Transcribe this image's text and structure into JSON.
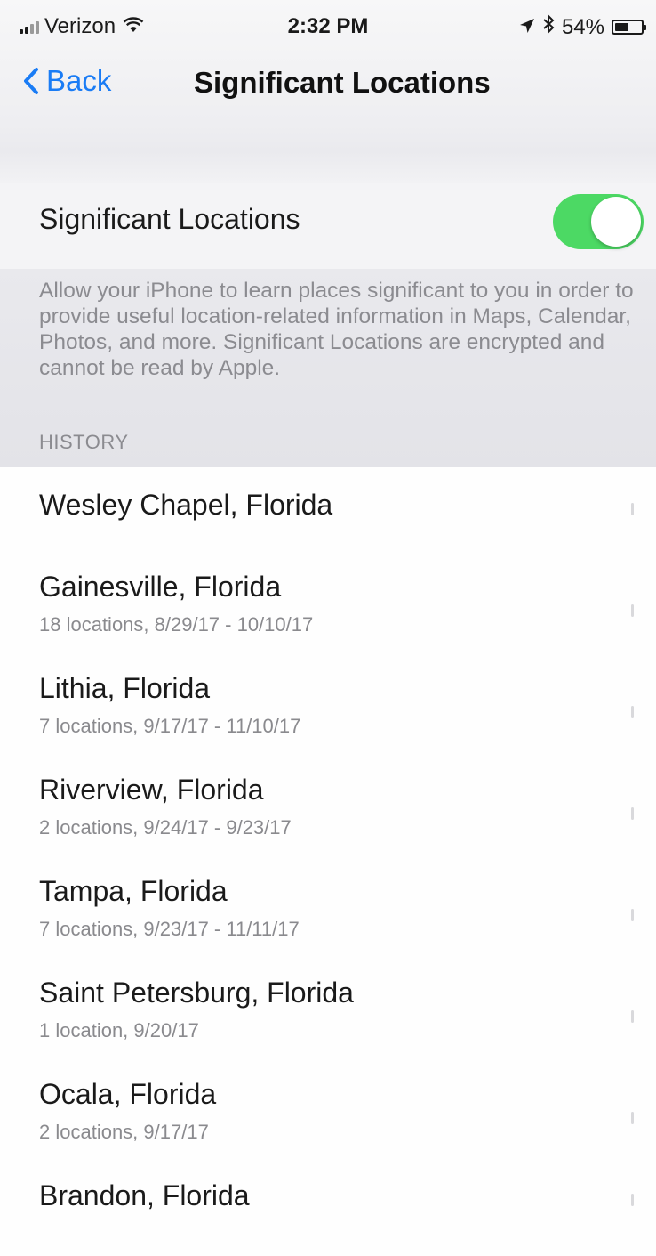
{
  "status_bar": {
    "carrier": "Verizon",
    "time": "2:32 PM",
    "battery_text": "54%",
    "battery_level": 0.54
  },
  "nav": {
    "back_label": "Back",
    "title": "Significant Locations"
  },
  "setting": {
    "label": "Significant Locations",
    "enabled": true,
    "toggle_color": "#4cd964",
    "description": "Allow your iPhone to learn places significant to you in order to provide useful location-related information in Maps, Calendar, Photos, and more. Significant Locations are encrypted and cannot be read by Apple."
  },
  "history": {
    "header": "HISTORY",
    "items": [
      {
        "name": "Wesley Chapel, Florida",
        "detail": ""
      },
      {
        "name": "Gainesville, Florida",
        "detail": "18 locations, 8/29/17 - 10/10/17"
      },
      {
        "name": "Lithia, Florida",
        "detail": "7 locations, 9/17/17 - 11/10/17"
      },
      {
        "name": "Riverview, Florida",
        "detail": "2 locations, 9/24/17 - 9/23/17"
      },
      {
        "name": "Tampa, Florida",
        "detail": "7 locations, 9/23/17 - 11/11/17"
      },
      {
        "name": "Saint Petersburg, Florida",
        "detail": "1 location, 9/20/17"
      },
      {
        "name": "Ocala, Florida",
        "detail": "2 locations, 9/17/17"
      },
      {
        "name": "Brandon, Florida",
        "detail": ""
      }
    ]
  },
  "accent_color": "#1a7cf5"
}
